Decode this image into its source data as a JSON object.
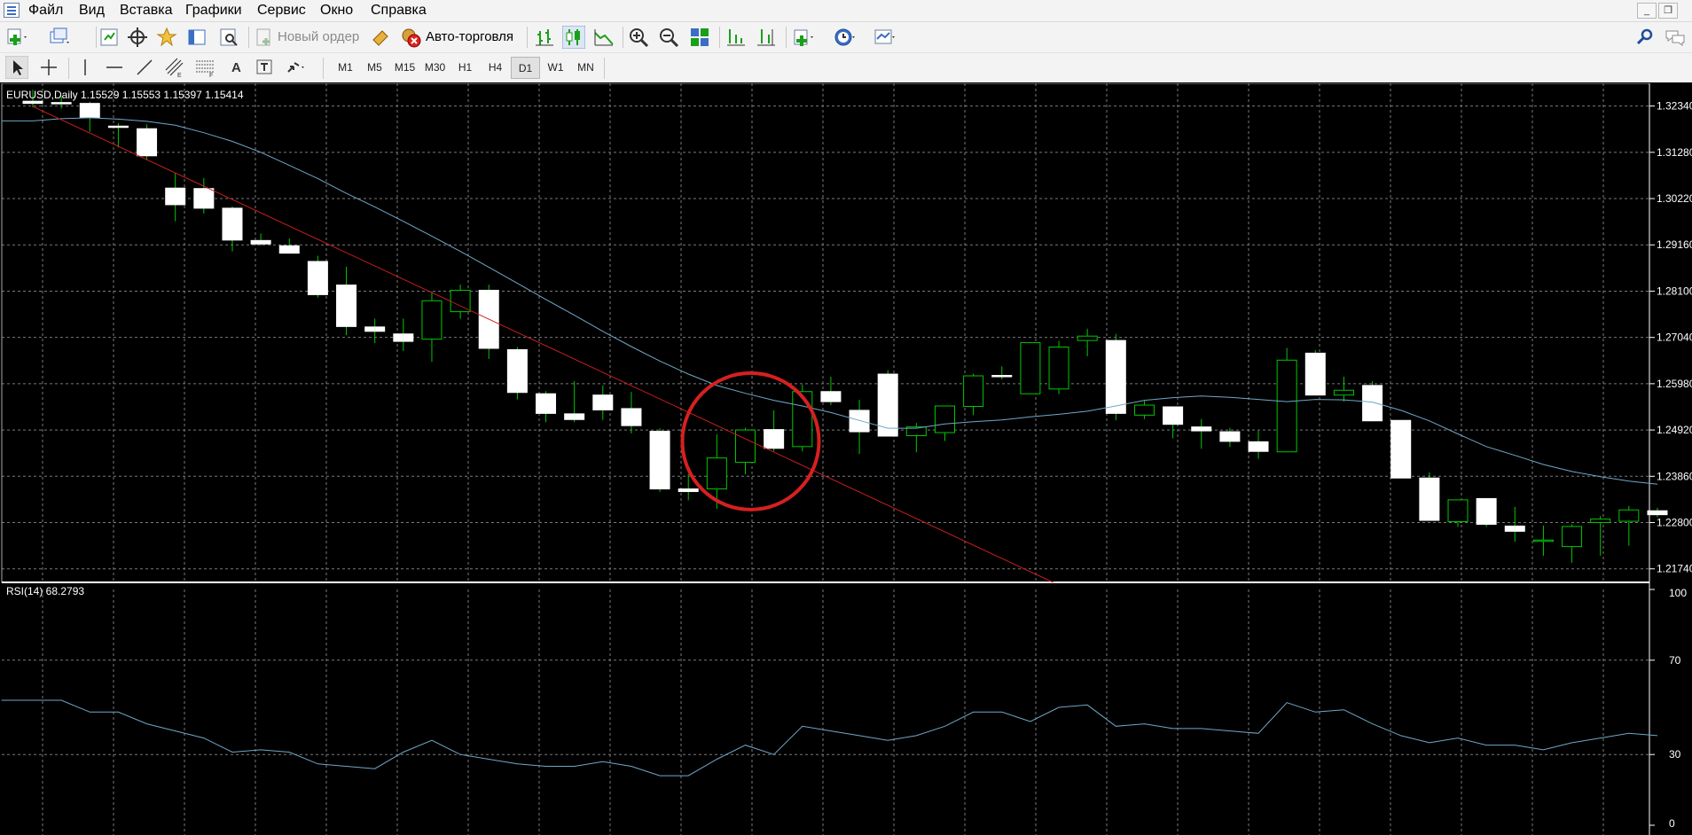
{
  "menu": [
    "Файл",
    "Вид",
    "Вставка",
    "Графики",
    "Сервис",
    "Окно",
    "Справка"
  ],
  "window_buttons": [
    "_",
    "❐"
  ],
  "toolbar1": {
    "new_order_label": "Новый ордер",
    "autotrading_label": "Авто-торговля"
  },
  "toolbar2": {
    "timeframes": [
      "M1",
      "M5",
      "M15",
      "M30",
      "H1",
      "H4",
      "D1",
      "W1",
      "MN"
    ],
    "active_timeframe": "D1",
    "text_tool": "A"
  },
  "chart": {
    "header_text": "EURUSD,Daily  1.15529 1.15553 1.15397 1.15414",
    "price_labels": [
      "1.32340",
      "1.31280",
      "1.30220",
      "1.29160",
      "1.28100",
      "1.27040",
      "1.25980",
      "1.24920",
      "1.23860",
      "1.22800",
      "1.21740"
    ],
    "bull_color": "#00c800",
    "bear_color": "#ffffff",
    "ma_color": "#6fa8c8",
    "trendline_color": "#c81e1e",
    "circle_color": "#d62020"
  },
  "rsi": {
    "header_text": "RSI(14) 68.2793",
    "labels": [
      "100",
      "70",
      "30",
      "0"
    ],
    "line_color": "#6fa8c8"
  },
  "chart_data": [
    {
      "type": "candlestick",
      "title": "EURUSD,Daily",
      "y_range": [
        1.2143,
        1.3286
      ],
      "ohlc": [
        [
          1.3245,
          1.3271,
          1.3231,
          1.324
        ],
        [
          1.3242,
          1.3256,
          1.3228,
          1.324
        ],
        [
          1.324,
          1.3244,
          1.3175,
          1.3208
        ],
        [
          1.3188,
          1.3195,
          1.3139,
          1.3186
        ],
        [
          1.3182,
          1.3192,
          1.311,
          1.312
        ],
        [
          1.3046,
          1.308,
          1.297,
          1.3008
        ],
        [
          1.3045,
          1.3069,
          1.2988,
          1.3
        ],
        [
          1.3,
          1.3004,
          1.2901,
          1.2927
        ],
        [
          1.2926,
          1.2942,
          1.2914,
          1.2918
        ],
        [
          1.2914,
          1.2931,
          1.2897,
          1.2897
        ],
        [
          1.2878,
          1.2891,
          1.2795,
          1.2802
        ],
        [
          1.2824,
          1.2866,
          1.2709,
          1.2729
        ],
        [
          1.2728,
          1.2747,
          1.2691,
          1.2718
        ],
        [
          1.2712,
          1.2747,
          1.2673,
          1.2695
        ],
        [
          1.27,
          1.2809,
          1.2648,
          1.2788
        ],
        [
          1.2763,
          1.2825,
          1.2747,
          1.2812
        ],
        [
          1.2812,
          1.2825,
          1.2655,
          1.2679
        ],
        [
          1.2676,
          1.2682,
          1.2562,
          1.2578
        ],
        [
          1.2575,
          1.2581,
          1.251,
          1.253
        ],
        [
          1.2529,
          1.2604,
          1.251,
          1.2516
        ],
        [
          1.2572,
          1.2594,
          1.2515,
          1.2538
        ],
        [
          1.2541,
          1.2579,
          1.2484,
          1.2502
        ],
        [
          1.2489,
          1.2496,
          1.235,
          1.2357
        ],
        [
          1.2357,
          1.2391,
          1.2331,
          1.2351
        ],
        [
          1.2357,
          1.2482,
          1.2311,
          1.2428
        ],
        [
          1.2418,
          1.2497,
          1.2391,
          1.2492
        ],
        [
          1.2493,
          1.2537,
          1.2443,
          1.245
        ],
        [
          1.2454,
          1.2596,
          1.2443,
          1.258
        ],
        [
          1.258,
          1.2614,
          1.2549,
          1.2557
        ],
        [
          1.2537,
          1.2561,
          1.2437,
          1.2488
        ],
        [
          1.262,
          1.2629,
          1.2489,
          1.2478
        ],
        [
          1.2479,
          1.2508,
          1.2441,
          1.2499
        ],
        [
          1.2486,
          1.2545,
          1.2467,
          1.2547
        ],
        [
          1.2546,
          1.2621,
          1.2526,
          1.2616
        ],
        [
          1.2617,
          1.2638,
          1.2608,
          1.2615
        ],
        [
          1.2575,
          1.2688,
          1.2575,
          1.2692
        ],
        [
          1.2586,
          1.2696,
          1.2574,
          1.2682
        ],
        [
          1.2697,
          1.2724,
          1.2661,
          1.2707
        ],
        [
          1.2697,
          1.2712,
          1.2514,
          1.253
        ],
        [
          1.2526,
          1.256,
          1.2517,
          1.2549
        ],
        [
          1.2545,
          1.2543,
          1.2473,
          1.2505
        ],
        [
          1.2499,
          1.2517,
          1.2449,
          1.249
        ],
        [
          1.2488,
          1.2497,
          1.2453,
          1.2466
        ],
        [
          1.2465,
          1.249,
          1.2426,
          1.2443
        ],
        [
          1.2442,
          1.268,
          1.2442,
          1.2652
        ],
        [
          1.2668,
          1.2675,
          1.2576,
          1.2572
        ],
        [
          1.2572,
          1.2614,
          1.2557,
          1.2583
        ],
        [
          1.2594,
          1.2604,
          1.2512,
          1.2513
        ],
        [
          1.2514,
          1.2514,
          1.2382,
          1.2382
        ],
        [
          1.2382,
          1.2395,
          1.2284,
          1.2285
        ],
        [
          1.2282,
          1.233,
          1.227,
          1.2332
        ],
        [
          1.2335,
          1.2335,
          1.227,
          1.2276
        ],
        [
          1.2272,
          1.2316,
          1.2236,
          1.226
        ],
        [
          1.2238,
          1.2273,
          1.2204,
          1.224
        ],
        [
          1.2225,
          1.2276,
          1.2188,
          1.2271
        ],
        [
          1.228,
          1.2295,
          1.2204,
          1.2288
        ],
        [
          1.2283,
          1.2318,
          1.2227,
          1.2309
        ],
        [
          1.2307,
          1.2314,
          1.2292,
          1.2298
        ]
      ],
      "moving_average": [
        1.32,
        1.3205,
        1.3207,
        1.3204,
        1.3199,
        1.319,
        1.3173,
        1.3153,
        1.3128,
        1.3098,
        1.3068,
        1.3034,
        1.3003,
        1.297,
        1.2936,
        1.2901,
        1.2865,
        1.2828,
        1.2791,
        1.2755,
        1.2718,
        1.2683,
        1.265,
        1.262,
        1.2594,
        1.2576,
        1.256,
        1.2547,
        1.2532,
        1.2514,
        1.2496,
        1.2496,
        1.2506,
        1.2511,
        1.2515,
        1.2522,
        1.2528,
        1.2535,
        1.2547,
        1.256,
        1.2566,
        1.257,
        1.2567,
        1.2562,
        1.2557,
        1.2562,
        1.2561,
        1.2556,
        1.2537,
        1.2513,
        1.2483,
        1.2454,
        1.2434,
        1.2413,
        1.2397,
        1.2385,
        1.2375,
        1.2368
      ],
      "trendline": [
        [
          0,
          1.3233
        ],
        [
          35.8,
          1.2143
        ]
      ]
    },
    {
      "type": "line",
      "title": "RSI(14) 68.2793",
      "y_range": [
        0,
        100
      ],
      "ticks": [
        100,
        70,
        30,
        0
      ],
      "values": [
        53,
        53,
        48,
        48,
        43,
        40,
        37,
        31,
        32,
        31,
        26,
        25,
        24,
        31,
        36,
        30,
        28,
        26,
        25,
        25,
        27,
        25,
        21,
        21,
        28,
        34,
        30,
        42,
        40,
        38,
        36,
        38,
        42,
        48,
        48,
        44,
        50,
        51,
        42,
        43,
        41,
        41,
        40,
        39,
        52,
        48,
        49,
        43,
        38,
        35,
        37,
        34,
        34,
        32,
        35,
        37,
        39,
        38
      ]
    }
  ]
}
